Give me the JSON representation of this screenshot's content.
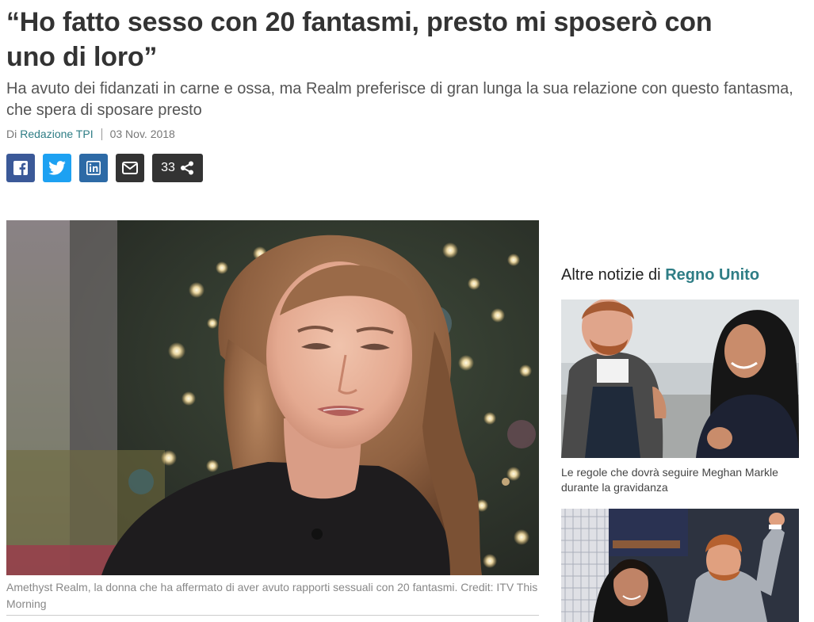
{
  "article": {
    "title": "“Ho fatto sesso con 20 fantasmi, presto mi sposerò con uno di loro”",
    "subtitle": "Ha avuto dei fidanzati in carne e ossa, ma Realm preferisce di gran lunga la sua relazione con questo fantasma, che spera di sposare presto",
    "byline_prefix": "Di",
    "author": "Redazione TPI",
    "date": "03 Nov. 2018",
    "caption": "Amethyst Realm, la donna che ha affermato di aver avuto rapporti sessuali con 20 fantasmi. Credit: ITV This Morning"
  },
  "share": {
    "count": "33",
    "icons": [
      "facebook-icon",
      "twitter-icon",
      "linkedin-icon",
      "email-icon",
      "share-icon"
    ],
    "colors": {
      "facebook": "#3b5998",
      "twitter": "#1da1f2",
      "linkedin": "#2d6aa6",
      "dark": "#333333"
    }
  },
  "sidebar": {
    "heading_prefix": "Altre notizie di",
    "heading_region": "Regno Unito",
    "accent": "#2e7d85",
    "items": [
      {
        "text": "Le regole che dovrà seguire Meghan Markle durante la gravidanza"
      }
    ]
  }
}
